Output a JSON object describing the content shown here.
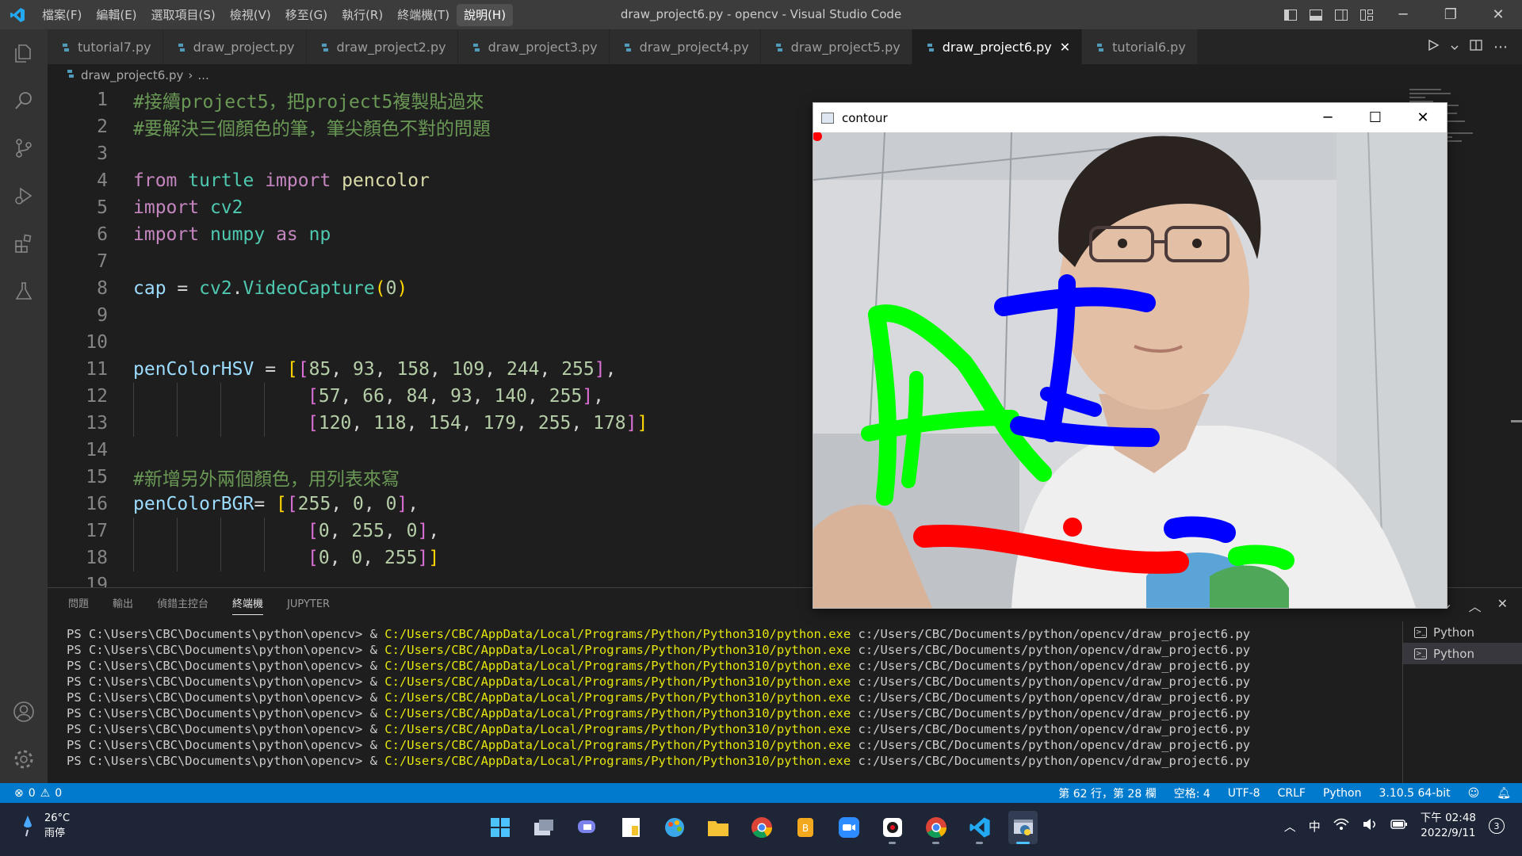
{
  "titlebar": {
    "menu": [
      "檔案(F)",
      "編輯(E)",
      "選取項目(S)",
      "檢視(V)",
      "移至(G)",
      "執行(R)",
      "終端機(T)",
      "說明(H)"
    ],
    "window_title": "draw_project6.py - opencv - Visual Studio Code"
  },
  "tabs": [
    {
      "label": "tutorial7.py",
      "active": false
    },
    {
      "label": "draw_project.py",
      "active": false
    },
    {
      "label": "draw_project2.py",
      "active": false
    },
    {
      "label": "draw_project3.py",
      "active": false
    },
    {
      "label": "draw_project4.py",
      "active": false
    },
    {
      "label": "draw_project5.py",
      "active": false
    },
    {
      "label": "draw_project6.py",
      "active": true
    },
    {
      "label": "tutorial6.py",
      "active": false
    }
  ],
  "breadcrumb": {
    "file": "draw_project6.py",
    "rest": "..."
  },
  "editor": {
    "line_numbers": [
      "1",
      "2",
      "3",
      "4",
      "5",
      "6",
      "7",
      "8",
      "9",
      "10",
      "11",
      "12",
      "13",
      "14",
      "15",
      "16",
      "17",
      "18",
      "19"
    ],
    "lines": {
      "l1": "#接續project5，把project5複製貼過來",
      "l2": "#要解決三個顏色的筆，筆尖顏色不對的問題",
      "l15": "#新增另外兩個顏色，用列表來寫"
    }
  },
  "panel": {
    "tabs": [
      "問題",
      "輸出",
      "偵錯主控台",
      "終端機",
      "JUPYTER"
    ],
    "active_tab": "終端機",
    "prompt": "PS C:\\Users\\CBC\\Documents\\python\\opencv> & ",
    "exe": "C:/Users/CBC/AppData/Local/Programs/Python/Python310/python.exe",
    "script": " c:/Users/CBC/Documents/python/opencv/draw_project6.py",
    "repeat_count": 9,
    "terminals": [
      "Python",
      "Python"
    ]
  },
  "statusbar": {
    "errors": "0",
    "warnings": "0",
    "position": "第 62 行，第 28 欄",
    "spaces": "空格: 4",
    "encoding": "UTF-8",
    "eol": "CRLF",
    "language": "Python",
    "version": "3.10.5 64-bit"
  },
  "taskbar": {
    "temp": "26°C",
    "weather": "雨停",
    "ime": "中",
    "time": "下午 02:48",
    "date": "2022/9/11",
    "notifications": "3"
  },
  "cvwindow": {
    "title": "contour"
  },
  "colors": {
    "accent": "#007acc",
    "red_stroke": "#ff0000",
    "green_stroke": "#00ff00",
    "blue_stroke": "#0000ff"
  }
}
